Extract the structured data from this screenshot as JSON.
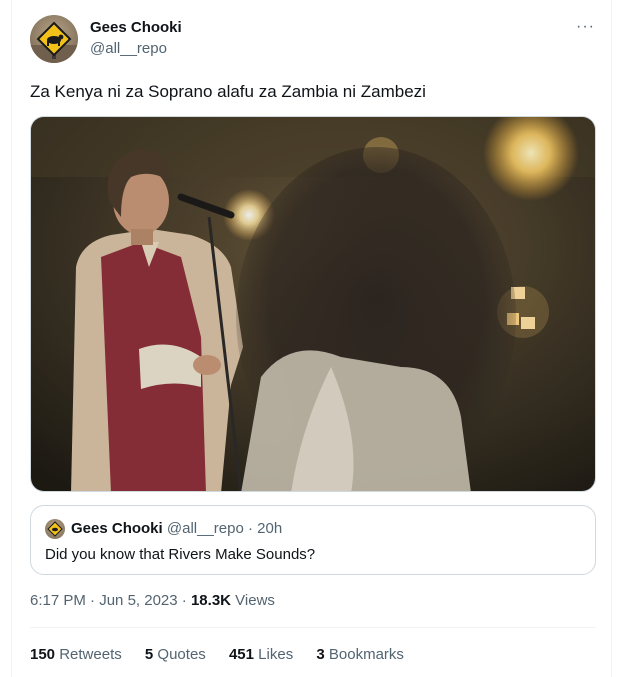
{
  "author": {
    "display_name": "Gees Chooki",
    "handle": "@all__repo",
    "avatar_icon": "road-sign-avatar"
  },
  "more_icon": "more-options-icon",
  "more_glyph": "···",
  "tweet_text": "Za Kenya ni za Soprano alafu za Zambia ni Zambezi",
  "media": {
    "type": "photo"
  },
  "quote": {
    "display_name": "Gees Chooki",
    "handle": "@all__repo",
    "separator": "·",
    "age": "20h",
    "text": "Did you know that Rivers Make Sounds?"
  },
  "meta": {
    "time": "6:17 PM",
    "separator": "·",
    "date": "Jun 5, 2023",
    "views_count": "18.3K",
    "views_label": "Views"
  },
  "stats": {
    "retweets_count": "150",
    "retweets_label": "Retweets",
    "quotes_count": "5",
    "quotes_label": "Quotes",
    "likes_count": "451",
    "likes_label": "Likes",
    "bookmarks_count": "3",
    "bookmarks_label": "Bookmarks"
  },
  "colors": {
    "text": "#0f1419",
    "secondary": "#536471",
    "border": "#cfd9de"
  }
}
